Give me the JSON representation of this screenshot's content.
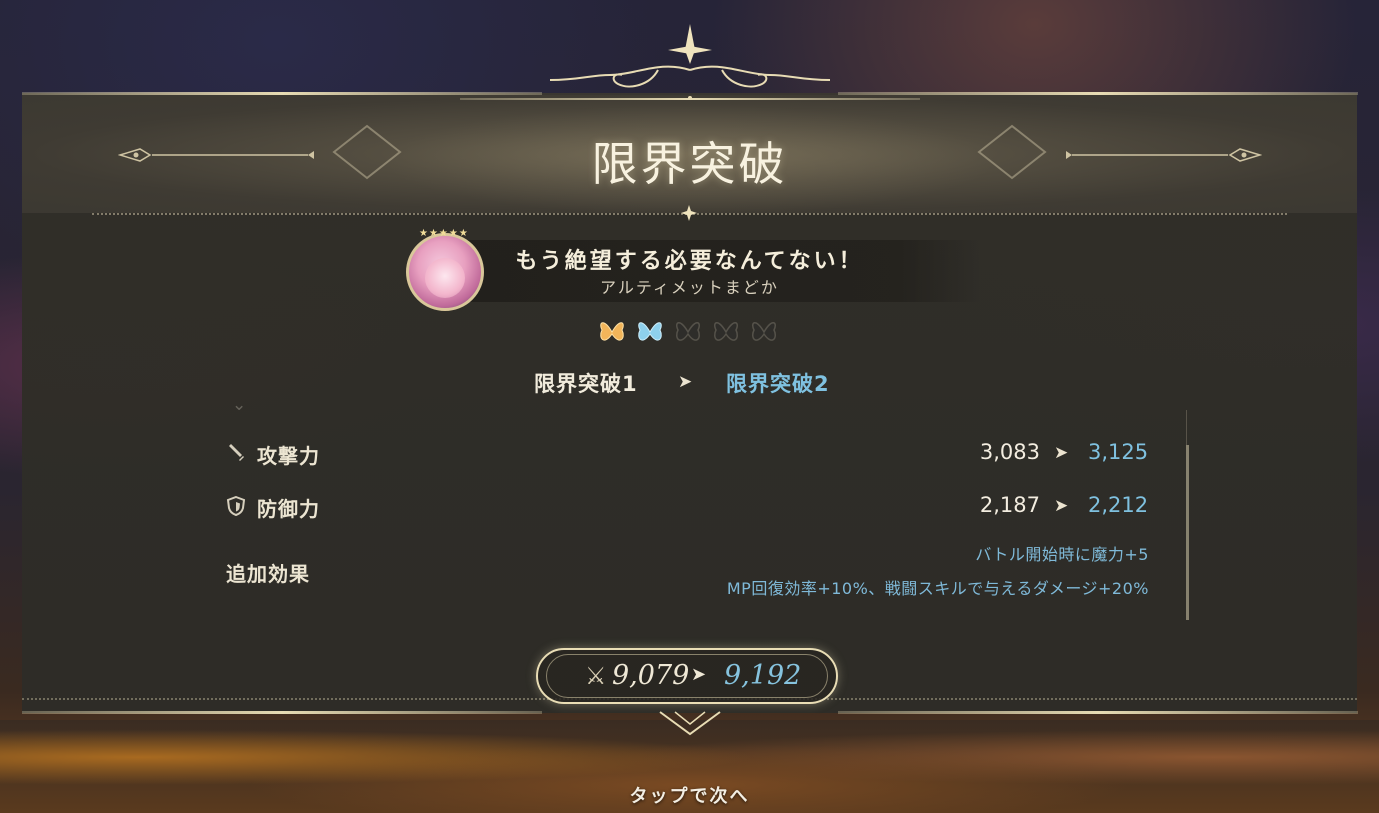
{
  "header": {
    "title": "限界突破"
  },
  "character": {
    "quote": "もう絶望する必要なんてない！",
    "name": "アルティメットまどか",
    "stars": "★★★★★"
  },
  "gems": [
    {
      "icon": "butterfly-gem-icon",
      "state": "filled",
      "color": "#f2b55a"
    },
    {
      "icon": "butterfly-gem-icon",
      "state": "filled",
      "color": "#8ed0ec"
    },
    {
      "icon": "butterfly-gem-icon",
      "state": "empty",
      "color": "#3a3935"
    },
    {
      "icon": "butterfly-gem-icon",
      "state": "empty",
      "color": "#3a3935"
    },
    {
      "icon": "butterfly-gem-icon",
      "state": "empty",
      "color": "#3a3935"
    }
  ],
  "breakthrough": {
    "from": "限界突破1",
    "to": "限界突破2"
  },
  "stats": [
    {
      "icon": "sword-icon",
      "label": "攻撃力",
      "old": "3,083",
      "new": "3,125"
    },
    {
      "icon": "shield-icon",
      "label": "防御力",
      "old": "2,187",
      "new": "2,212"
    }
  ],
  "extra_effects": {
    "label": "追加効果",
    "lines": [
      "バトル開始時に魔力+5",
      "MP回復効率+10%、戦闘スキルで与えるダメージ+20%"
    ]
  },
  "power": {
    "old": "9,079",
    "new": "9,192"
  },
  "footer": {
    "tap_hint": "タップで次へ"
  },
  "colors": {
    "gold": "#e8dcb4",
    "new_value_blue": "#7fc1e0"
  }
}
